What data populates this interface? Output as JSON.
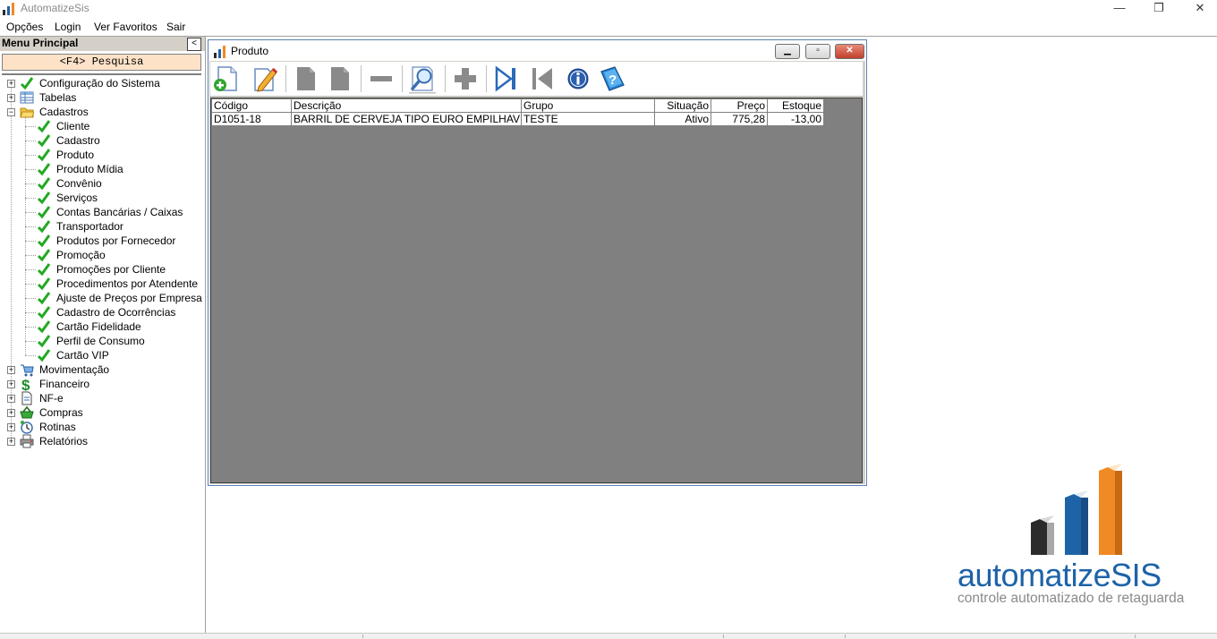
{
  "app": {
    "title": "AutomatizeSis"
  },
  "window_controls": {
    "minimize": "—",
    "restore": "❐",
    "close": "✕"
  },
  "menu": [
    "Opções",
    "Login",
    "Ver Favoritos",
    "Sair"
  ],
  "sidebar": {
    "title": "Menu Principal",
    "collapse_label": "<",
    "search_label": "<F4> Pesquisa",
    "tree": [
      {
        "label": "Configuração do Sistema",
        "icon": "check-icon",
        "expander": "+"
      },
      {
        "label": "Tabelas",
        "icon": "table-icon",
        "expander": "+"
      },
      {
        "label": "Cadastros",
        "icon": "folder-open-icon",
        "expander": "−",
        "children": [
          "Cliente",
          "Cadastro",
          "Produto",
          "Produto Mídia",
          "Convênio",
          "Serviços",
          "Contas Bancárias / Caixas",
          "Transportador",
          "Produtos por Fornecedor",
          "Promoção",
          "Promoções por Cliente",
          "Procedimentos por Atendente",
          "Ajuste de Preços por Empresa",
          "Cadastro de Ocorrências",
          "Cartão Fidelidade",
          "Perfil de Consumo",
          "Cartão VIP"
        ]
      },
      {
        "label": "Movimentação",
        "icon": "cart-icon",
        "expander": "+"
      },
      {
        "label": "Financeiro",
        "icon": "dollar-icon",
        "expander": "+"
      },
      {
        "label": "NF-e",
        "icon": "document-icon",
        "expander": "+"
      },
      {
        "label": "Compras",
        "icon": "basket-icon",
        "expander": "+"
      },
      {
        "label": "Rotinas",
        "icon": "clock-icon",
        "expander": "+"
      },
      {
        "label": "Relatórios",
        "icon": "printer-icon",
        "expander": "+"
      }
    ]
  },
  "product_window": {
    "title": "Produto",
    "controls": {
      "minimize": "▁",
      "restore": "▫",
      "close": "✕"
    },
    "toolbar": [
      "new-icon",
      "edit-icon",
      "save-icon",
      "cancel-icon",
      "delete-icon",
      "search-icon",
      "add-icon",
      "last-icon",
      "first-icon",
      "info-icon",
      "help-icon"
    ],
    "grid": {
      "columns": [
        "Código",
        "Descrição",
        "Grupo",
        "Situação",
        "Preço",
        "Estoque"
      ],
      "rows": [
        [
          "D1051-18",
          "BARRIL DE CERVEJA TIPO EURO EMPILHAVEL C/",
          "TESTE",
          "Ativo",
          "775,28",
          "-13,00"
        ]
      ]
    }
  },
  "logo": {
    "name_part1": "automatize",
    "name_part2": "SIS",
    "tagline": "controle automatizado de retaguarda",
    "colors": {
      "dark": "#2b2b2b",
      "blue": "#1e63a8",
      "orange": "#f08a24",
      "gray": "#8a8a8a"
    }
  }
}
